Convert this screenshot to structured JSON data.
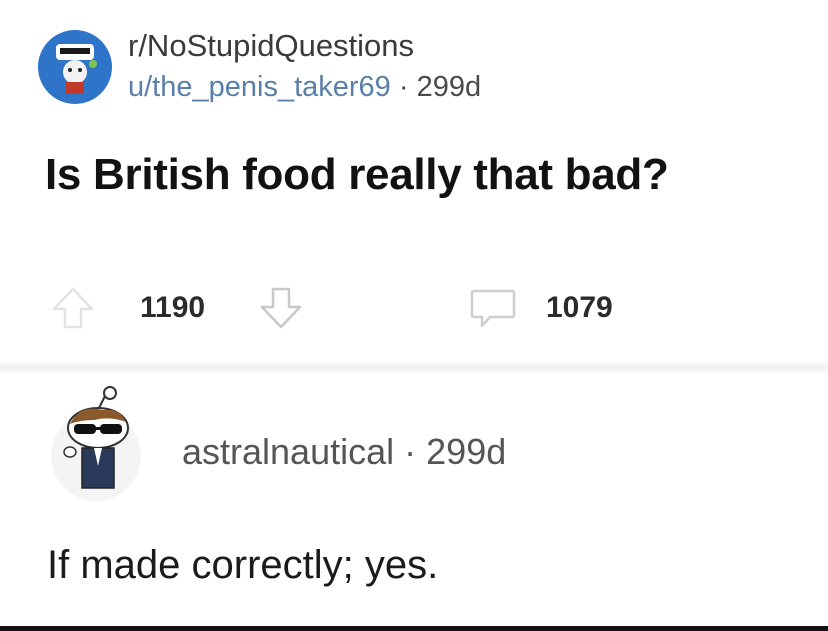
{
  "post": {
    "subreddit": "r/NoStupidQuestions",
    "author": "u/the_penis_taker69",
    "separator": "·",
    "age": "299d",
    "title": "Is British food really that bad?",
    "upvotes": "1190",
    "comments": "1079"
  },
  "comment": {
    "author": "astralnautical",
    "separator": "·",
    "age": "299d",
    "body": "If made correctly; yes."
  },
  "colors": {
    "subreddit_avatar_bg": "#2e74c9",
    "username_link": "#5a7fa8"
  },
  "icons": {
    "upvote": "arrow-up-outline-icon",
    "downvote": "arrow-down-outline-icon",
    "comments": "speech-bubble-icon"
  }
}
